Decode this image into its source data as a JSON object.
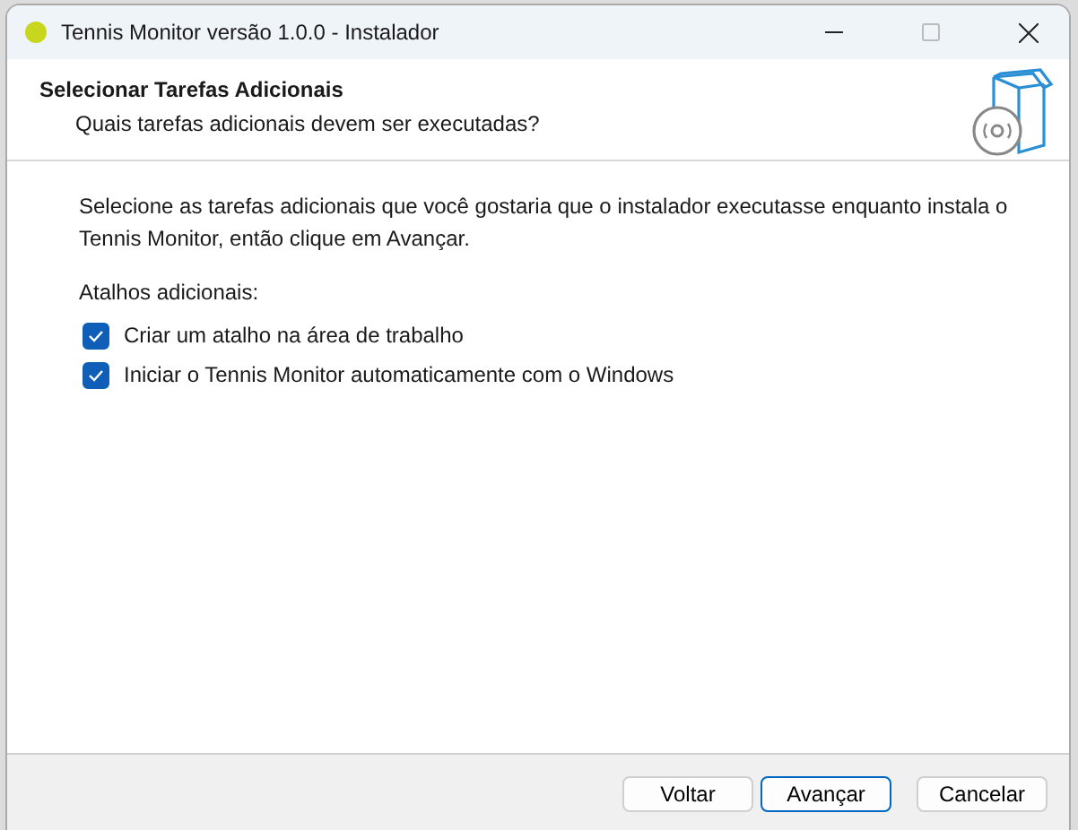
{
  "window": {
    "title": "Tennis Monitor versão 1.0.0 - Instalador"
  },
  "header": {
    "title": "Selecionar Tarefas Adicionais",
    "subtitle": "Quais tarefas adicionais devem ser executadas?"
  },
  "description": "Selecione as tarefas adicionais que você gostaria que o instalador executasse enquanto instala o Tennis Monitor, então clique em Avançar.",
  "group_label": "Atalhos adicionais:",
  "tasks": [
    {
      "label": "Criar um atalho na área de trabalho",
      "checked": true
    },
    {
      "label": "Iniciar o Tennis Monitor automaticamente com o Windows",
      "checked": true
    }
  ],
  "buttons": [
    {
      "label": "Voltar",
      "selected": false
    },
    {
      "label": "Avançar",
      "selected": true
    },
    {
      "label": "Cancelar",
      "selected": false
    }
  ]
}
